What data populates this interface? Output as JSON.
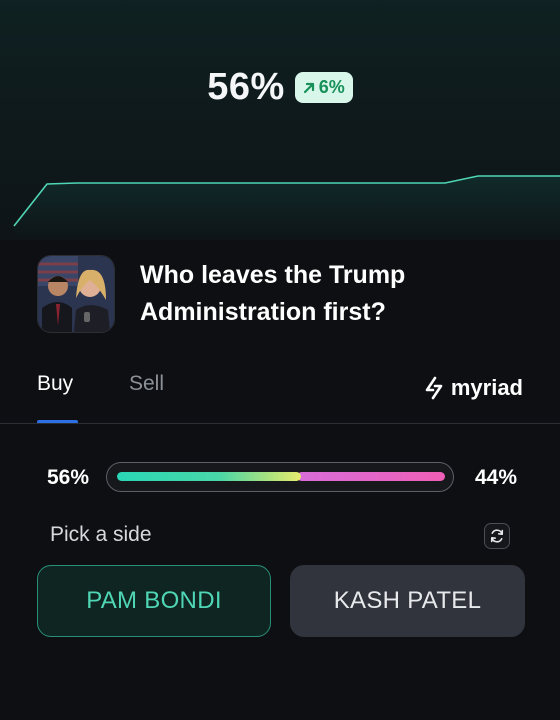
{
  "headline": {
    "probability": "56%",
    "change": "6%",
    "change_direction": "up"
  },
  "colors": {
    "accent_teal": "#4fd6b5",
    "accent_blue": "#2f6fe4",
    "badge_bg": "#d8f6ea",
    "badge_text": "#17905a",
    "no_pink": "#ef5fb6"
  },
  "market": {
    "question": "Who leaves the Trump Administration first?",
    "image_icon": "market-portrait-image"
  },
  "tabs": [
    {
      "label": "Buy",
      "active": true
    },
    {
      "label": "Sell",
      "active": false
    }
  ],
  "brand": {
    "name": "myriad",
    "icon": "myriad-logo-icon"
  },
  "odds": {
    "left_label": "56%",
    "right_label": "44%",
    "left_fraction": 0.56
  },
  "pick": {
    "label": "Pick a side",
    "refresh_icon": "refresh-icon"
  },
  "sides": {
    "yes": "PAM BONDI",
    "no": "KASH PATEL"
  }
}
